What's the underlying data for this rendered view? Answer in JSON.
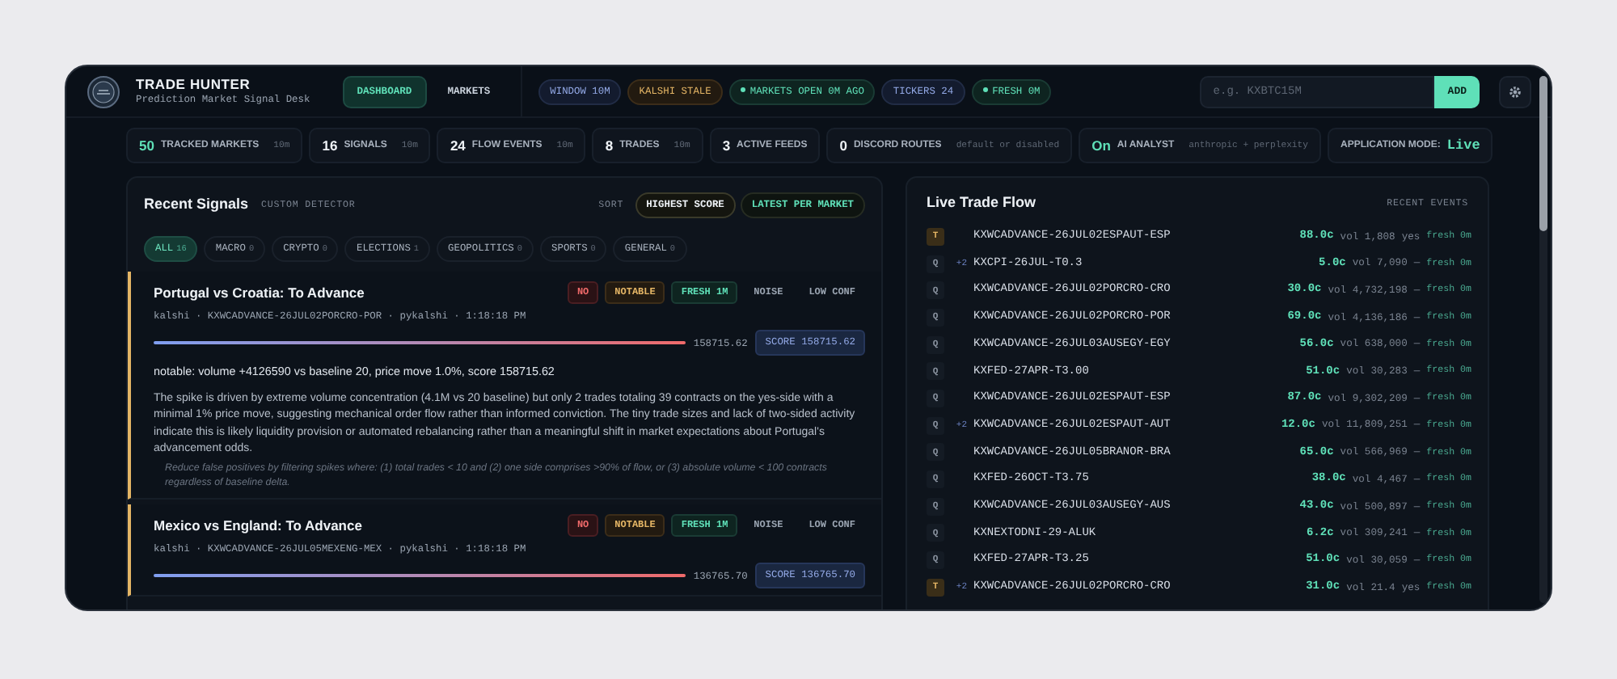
{
  "app": {
    "title": "TRADE HUNTER",
    "subtitle": "Prediction Market Signal Desk"
  },
  "nav": [
    {
      "label": "DASHBOARD",
      "selected": true
    },
    {
      "label": "MARKETS",
      "selected": false
    }
  ],
  "status_chips": [
    {
      "label": "WINDOW 10M",
      "kind": "info",
      "dot": false
    },
    {
      "label": "KALSHI STALE",
      "kind": "warn",
      "dot": false
    },
    {
      "label": "MARKETS OPEN 0M AGO",
      "kind": "ok",
      "dot": true
    },
    {
      "label": "TICKERS 24",
      "kind": "info",
      "dot": false
    },
    {
      "label": "FRESH 0M",
      "kind": "ok",
      "dot": true
    }
  ],
  "ticker_input": {
    "placeholder": "e.g. KXBTC15M",
    "button": "ADD"
  },
  "stats": [
    {
      "value": "50",
      "label": "TRACKED MARKETS",
      "note": "10m",
      "highlight": true
    },
    {
      "value": "16",
      "label": "SIGNALS",
      "note": "10m",
      "highlight": false
    },
    {
      "value": "24",
      "label": "FLOW EVENTS",
      "note": "10m",
      "highlight": false
    },
    {
      "value": "8",
      "label": "TRADES",
      "note": "10m",
      "highlight": false
    },
    {
      "value": "3",
      "label": "ACTIVE FEEDS",
      "highlight": false
    },
    {
      "value": "0",
      "label": "DISCORD ROUTES",
      "note": "default or disabled",
      "highlight": false
    },
    {
      "value": "On",
      "label": "AI ANALYST",
      "note": "anthropic + perplexity",
      "highlight": true
    },
    {
      "label": "APPLICATION MODE:",
      "value": "Live",
      "highlight": true,
      "kind": "mode"
    }
  ],
  "signals_panel": {
    "title": "Recent Signals",
    "subtitle": "CUSTOM DETECTOR",
    "sort_label": "SORT",
    "sort_options": [
      {
        "label": "HIGHEST SCORE",
        "selected": true
      },
      {
        "label": "LATEST PER MARKET",
        "selected": false
      }
    ],
    "filters": [
      {
        "label": "ALL",
        "count": "16",
        "selected": true
      },
      {
        "label": "MACRO",
        "count": "0",
        "selected": false
      },
      {
        "label": "CRYPTO",
        "count": "0",
        "selected": false
      },
      {
        "label": "ELECTIONS",
        "count": "1",
        "selected": false
      },
      {
        "label": "GEOPOLITICS",
        "count": "0",
        "selected": false
      },
      {
        "label": "SPORTS",
        "count": "0",
        "selected": false
      },
      {
        "label": "GENERAL",
        "count": "0",
        "selected": false
      }
    ],
    "signals": [
      {
        "title": "Portugal vs Croatia: To Advance",
        "tags": [
          {
            "label": "NO",
            "kind": "bad"
          },
          {
            "label": "NOTABLE",
            "kind": "warn"
          },
          {
            "label": "FRESH 1M",
            "kind": "ok"
          },
          {
            "label": "NOISE",
            "kind": "plain"
          },
          {
            "label": "LOW CONF",
            "kind": "plain"
          }
        ],
        "meta": "kalshi · KXWCADVANCE-26JUL02PORCRO-POR · pykalshi · 1:18:18 PM",
        "bar_value": "158715.62",
        "score": "SCORE 158715.62",
        "summary": "notable: volume +4126590 vs baseline 20, price move 1.0%, score 158715.62",
        "analysis": "The spike is driven by extreme volume concentration (4.1M vs 20 baseline) but only 2 trades totaling 39 contracts on the yes-side with a minimal 1% price move, suggesting mechanical order flow rather than informed conviction. The tiny trade sizes and lack of two-sided activity indicate this is likely liquidity provision or automated rebalancing rather than a meaningful shift in market expectations about Portugal's advancement odds.",
        "suggestion": "Reduce false positives by filtering spikes where: (1) total trades < 10 and (2) one side comprises >90% of flow, or (3) absolute volume < 100 contracts regardless of baseline delta."
      },
      {
        "title": "Mexico vs England: To Advance",
        "tags": [
          {
            "label": "NO",
            "kind": "bad"
          },
          {
            "label": "NOTABLE",
            "kind": "warn"
          },
          {
            "label": "FRESH 1M",
            "kind": "ok"
          },
          {
            "label": "NOISE",
            "kind": "plain"
          },
          {
            "label": "LOW CONF",
            "kind": "plain"
          }
        ],
        "meta": "kalshi · KXWCADVANCE-26JUL05MEXENG-MEX · pykalshi · 1:18:18 PM",
        "bar_value": "136765.70",
        "score": "SCORE 136765.70"
      }
    ]
  },
  "flow_panel": {
    "title": "Live Trade Flow",
    "subtitle": "RECENT EVENTS",
    "rows": [
      {
        "kind": "trade",
        "badge": "T",
        "ticker": "KXWCADVANCE-26JUL02ESPAUT-ESP",
        "price": "88.0c",
        "volume": "vol 1,808",
        "side": "yes",
        "fresh": "fresh 0m"
      },
      {
        "kind": "quote",
        "badge": "Q",
        "count": "+2",
        "ticker": "KXCPI-26JUL-T0.3",
        "price": "5.0c",
        "volume": "vol 7,090",
        "side": "—",
        "fresh": "fresh 0m"
      },
      {
        "kind": "quote",
        "badge": "Q",
        "ticker": "KXWCADVANCE-26JUL02PORCRO-CRO",
        "price": "30.0c",
        "volume": "vol 4,732,198",
        "side": "—",
        "fresh": "fresh 0m"
      },
      {
        "kind": "quote",
        "badge": "Q",
        "ticker": "KXWCADVANCE-26JUL02PORCRO-POR",
        "price": "69.0c",
        "volume": "vol 4,136,186",
        "side": "—",
        "fresh": "fresh 0m"
      },
      {
        "kind": "quote",
        "badge": "Q",
        "ticker": "KXWCADVANCE-26JUL03AUSEGY-EGY",
        "price": "56.0c",
        "volume": "vol 638,000",
        "side": "—",
        "fresh": "fresh 0m"
      },
      {
        "kind": "quote",
        "badge": "Q",
        "ticker": "KXFED-27APR-T3.00",
        "price": "51.0c",
        "volume": "vol 30,283",
        "side": "—",
        "fresh": "fresh 0m"
      },
      {
        "kind": "quote",
        "badge": "Q",
        "ticker": "KXWCADVANCE-26JUL02ESPAUT-ESP",
        "price": "87.0c",
        "volume": "vol 9,302,209",
        "side": "—",
        "fresh": "fresh 0m"
      },
      {
        "kind": "quote",
        "badge": "Q",
        "count": "+2",
        "ticker": "KXWCADVANCE-26JUL02ESPAUT-AUT",
        "price": "12.0c",
        "volume": "vol 11,809,251",
        "side": "—",
        "fresh": "fresh 0m"
      },
      {
        "kind": "quote",
        "badge": "Q",
        "ticker": "KXWCADVANCE-26JUL05BRANOR-BRA",
        "price": "65.0c",
        "volume": "vol 566,969",
        "side": "—",
        "fresh": "fresh 0m"
      },
      {
        "kind": "quote",
        "badge": "Q",
        "ticker": "KXFED-26OCT-T3.75",
        "price": "38.0c",
        "volume": "vol 4,467",
        "side": "—",
        "fresh": "fresh 0m"
      },
      {
        "kind": "quote",
        "badge": "Q",
        "ticker": "KXWCADVANCE-26JUL03AUSEGY-AUS",
        "price": "43.0c",
        "volume": "vol 500,897",
        "side": "—",
        "fresh": "fresh 0m"
      },
      {
        "kind": "quote",
        "badge": "Q",
        "ticker": "KXNEXTODNI-29-ALUK",
        "price": "6.2c",
        "volume": "vol 309,241",
        "side": "—",
        "fresh": "fresh 0m"
      },
      {
        "kind": "quote",
        "badge": "Q",
        "ticker": "KXFED-27APR-T3.25",
        "price": "51.0c",
        "volume": "vol 30,059",
        "side": "—",
        "fresh": "fresh 0m"
      },
      {
        "kind": "trade",
        "badge": "T",
        "count": "+2",
        "ticker": "KXWCADVANCE-26JUL02PORCRO-CRO",
        "price": "31.0c",
        "volume": "vol 21.4",
        "side": "yes",
        "fresh": "fresh 0m"
      }
    ]
  }
}
